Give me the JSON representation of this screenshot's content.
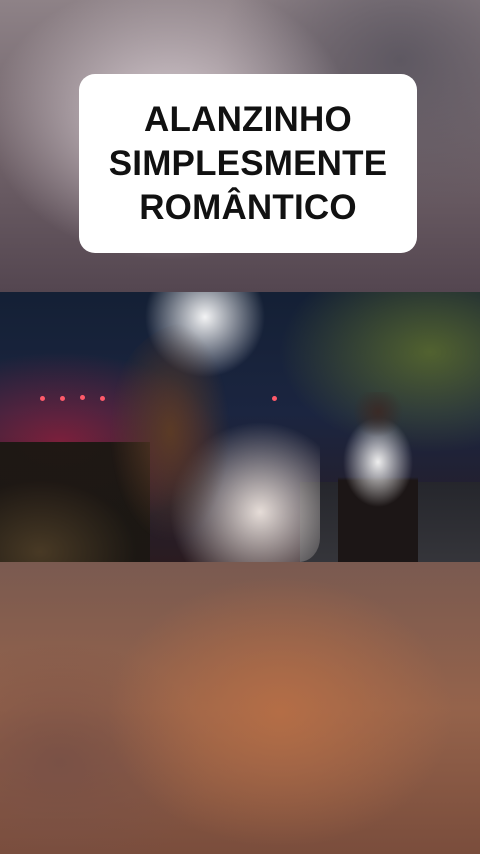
{
  "title_card": {
    "lines": [
      "ALANZINHO",
      "SIMPLESMENTE",
      "ROMÂNTICO"
    ]
  },
  "video": {
    "description_icon": "concert-video-frame"
  }
}
